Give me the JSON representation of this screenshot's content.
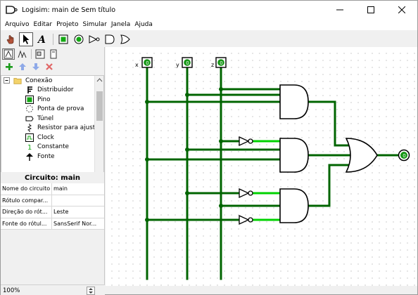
{
  "window": {
    "title": "Logisim: main de Sem título",
    "buttons": [
      "minimize",
      "maximize",
      "close"
    ]
  },
  "menu": [
    "Arquivo",
    "Editar",
    "Projeto",
    "Simular",
    "Janela",
    "Ajuda"
  ],
  "toolbar": {
    "tools": [
      "poke-tool",
      "select-tool",
      "text-tool",
      "input-pin",
      "output-pin",
      "not-gate",
      "and-gate",
      "or-gate"
    ]
  },
  "tree": {
    "folder": "Conexão",
    "items": [
      "Distribuidor",
      "Pino",
      "Ponta de prova",
      "Túnel",
      "Resistor para ajuste",
      "Clock",
      "Constante",
      "Fonte"
    ]
  },
  "properties": {
    "header": "Circuito: main",
    "rows": [
      {
        "key": "Nome do circuito",
        "value": "main"
      },
      {
        "key": "Rótulo compar...",
        "value": ""
      },
      {
        "key": "Direção do rót...",
        "value": "Leste"
      },
      {
        "key": "Fonte do rótul...",
        "value": "SansSerif Nor..."
      }
    ]
  },
  "status": {
    "zoom": "100%"
  },
  "circuit": {
    "inputs": [
      {
        "label": "x",
        "value": "0"
      },
      {
        "label": "y",
        "value": "0"
      },
      {
        "label": "z",
        "value": "0"
      }
    ],
    "output": {
      "value": "0"
    },
    "colors": {
      "wire_dark": "#006400",
      "wire_light": "#00d200",
      "pin_green": "#149614"
    }
  }
}
